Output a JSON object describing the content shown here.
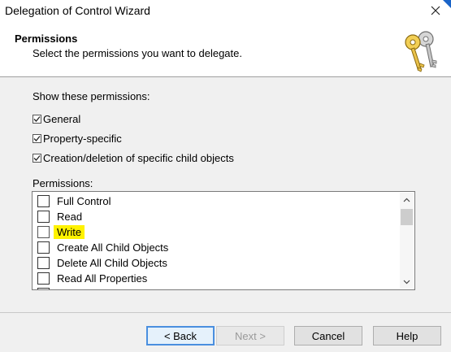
{
  "window": {
    "title": "Delegation of Control Wizard",
    "close_glyph": "✕"
  },
  "header": {
    "title": "Permissions",
    "subtitle": "Select the permissions you want to delegate.",
    "icon": "keys-icon"
  },
  "show_section": {
    "label": "Show these permissions:",
    "options": [
      {
        "label": "General",
        "checked": true
      },
      {
        "label": "Property-specific",
        "checked": true
      },
      {
        "label": "Creation/deletion of specific child objects",
        "checked": true
      }
    ]
  },
  "permissions": {
    "label": "Permissions:",
    "items": [
      {
        "label": "Full Control",
        "checked": false
      },
      {
        "label": "Read",
        "checked": false
      },
      {
        "label": "Write",
        "checked": false,
        "highlighted": true,
        "highlight_color": "#fff200"
      },
      {
        "label": "Create All Child Objects",
        "checked": false
      },
      {
        "label": "Delete All Child Objects",
        "checked": false
      },
      {
        "label": "Read All Properties",
        "checked": false
      }
    ]
  },
  "buttons": {
    "back": "< Back",
    "next": "Next >",
    "cancel": "Cancel",
    "help": "Help"
  },
  "colors": {
    "default_button_border": "#4a8fdf",
    "highlight": "#fff200"
  }
}
